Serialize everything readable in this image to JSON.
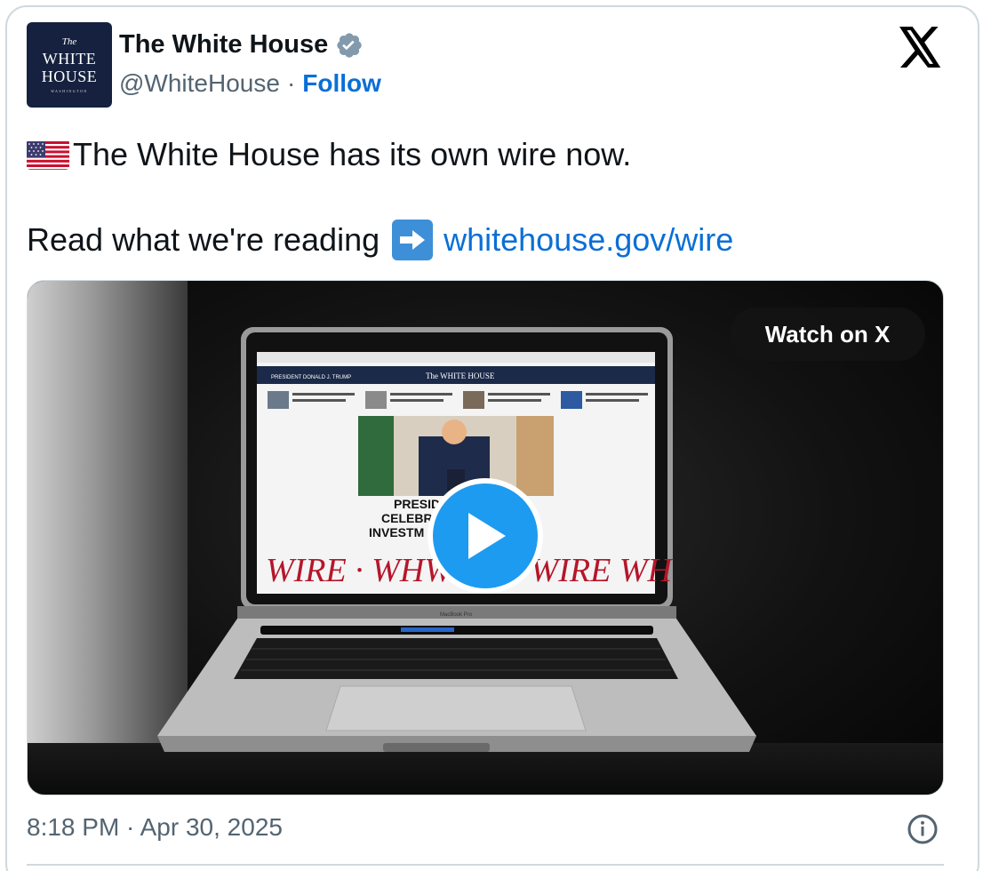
{
  "author": {
    "display_name": "The White House",
    "handle": "@WhiteHouse",
    "separator": "·",
    "follow_label": "Follow",
    "avatar": {
      "line_the": "The",
      "line_1": "WHITE",
      "line_2": "HOUSE",
      "line_3": "WASHINGTON"
    }
  },
  "tweet": {
    "line1": "The White House has its own wire now.",
    "line2_text": "Read what we're reading",
    "link_text": "whitehouse.gov/wire"
  },
  "media": {
    "watch_label": "Watch on X",
    "screen_nav": "PRESIDENT DONALD J. TRUMP",
    "screen_brand": "The WHITE HOUSE",
    "screen_headline": [
      "PRESID",
      "CELEBR",
      "INVESTM"
    ],
    "screen_ticker": "WIRE · WHWIRE · WIRE   WH",
    "laptop_label": "MacBook Pro"
  },
  "footer": {
    "timestamp": "8:18 PM · Apr 30, 2025"
  },
  "colors": {
    "link": "#0a6fd6",
    "play": "#1d9bf0",
    "verified": "#829aab",
    "avatar_bg": "#15213f"
  },
  "icons": [
    "verified-badge-icon",
    "x-logo-icon",
    "us-flag-icon",
    "right-arrow-icon",
    "play-icon",
    "info-icon"
  ]
}
